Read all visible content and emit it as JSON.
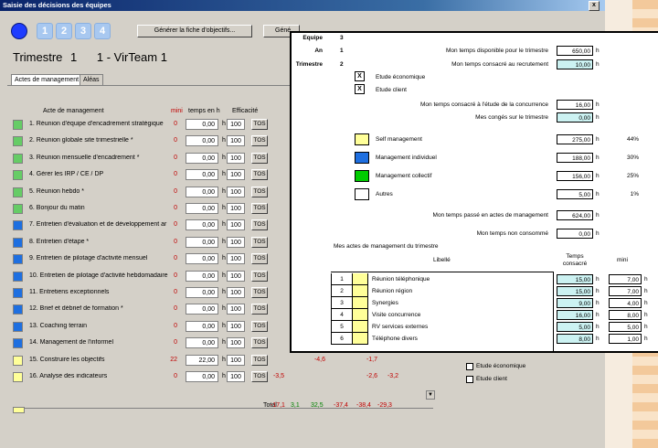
{
  "window": {
    "title": "Saisie des décisions des équipes",
    "close_label": "x"
  },
  "steps": [
    "1",
    "2",
    "3",
    "4"
  ],
  "buttons": {
    "generate_objectives": "Générer la fiche d'objectifs...",
    "generate_partial": "Géné"
  },
  "header": {
    "trimestre_label": "Trimestre",
    "trimestre_value": "1",
    "team": "1 - VirTeam 1"
  },
  "tabs": [
    "Actes de management",
    "Aléas"
  ],
  "columns": {
    "acte": "Acte de management",
    "mini": "mini",
    "temps": "temps en h",
    "efficacite": "Efficacité"
  },
  "hour_unit": "h",
  "tos_label": "TOS",
  "colors": {
    "green": "#66cc66",
    "blue": "#1e6fe0",
    "yellow": "#ffff99",
    "white": "#ffffff",
    "red": "#c00000"
  },
  "rows": [
    {
      "label": "1. Réunion d'équipe d'encadrement stratégique",
      "color": "#66cc66",
      "mini": "0",
      "temps": "0,00",
      "eff": "100",
      "c": []
    },
    {
      "label": "2. Réunion globale site trimestrielle *",
      "color": "#66cc66",
      "mini": "0",
      "temps": "0,00",
      "eff": "100",
      "c": []
    },
    {
      "label": "3. Réunion mensuelle d'encadrement *",
      "color": "#66cc66",
      "mini": "0",
      "temps": "0,00",
      "eff": "100",
      "c": [
        {
          "v": "-3",
          "cls": "red"
        }
      ]
    },
    {
      "label": "4. Gérer les IRP / CE / DP",
      "color": "#66cc66",
      "mini": "0",
      "temps": "0,00",
      "eff": "100",
      "c": []
    },
    {
      "label": "5. Réunion hebdo *",
      "color": "#66cc66",
      "mini": "0",
      "temps": "0,00",
      "eff": "100",
      "c": [
        {
          "v": "-5",
          "cls": "red"
        }
      ]
    },
    {
      "label": "6. Bonjour du matin",
      "color": "#66cc66",
      "mini": "0",
      "temps": "0,00",
      "eff": "100",
      "c": []
    },
    {
      "label": "7. Entretien d'évaluation et de développement ar",
      "color": "#1e6fe0",
      "mini": "0",
      "temps": "0,00",
      "eff": "100",
      "c": [
        {
          "v": "1",
          "cls": "green"
        }
      ]
    },
    {
      "label": "8. Entretien d'étape *",
      "color": "#1e6fe0",
      "mini": "0",
      "temps": "0,00",
      "eff": "100",
      "c": []
    },
    {
      "label": "9. Entretien de pilotage d'activité mensuel",
      "color": "#1e6fe0",
      "mini": "0",
      "temps": "0,00",
      "eff": "100",
      "c": [
        {
          "v": "-5",
          "cls": "red"
        }
      ]
    },
    {
      "label": "10. Entretien de pilotage d'activité hebdomadaire",
      "color": "#1e6fe0",
      "mini": "0",
      "temps": "0,00",
      "eff": "100",
      "c": [
        {
          "v": "-5",
          "cls": "red"
        }
      ]
    },
    {
      "label": "11. Entretiens exceptionnels",
      "color": "#1e6fe0",
      "mini": "0",
      "temps": "0,00",
      "eff": "100",
      "c": []
    },
    {
      "label": "12. Brief et débrief de formation *",
      "color": "#1e6fe0",
      "mini": "0",
      "temps": "0,00",
      "eff": "100",
      "c": []
    },
    {
      "label": "13. Coaching terrain",
      "color": "#1e6fe0",
      "mini": "0",
      "temps": "0,00",
      "eff": "100",
      "c": []
    },
    {
      "label": "14. Management de l'informel",
      "color": "#1e6fe0",
      "mini": "0",
      "temps": "0,00",
      "eff": "100",
      "c": []
    },
    {
      "label": "15. Construire les objectifs",
      "color": "#ffff99",
      "mini": "22",
      "temps": "22,00",
      "eff": "100",
      "c": [
        {
          "v": "-4,6",
          "cls": "red"
        },
        {
          "v": "-1,7",
          "cls": "red"
        }
      ]
    },
    {
      "label": "16. Analyse des indicateurs",
      "color": "#ffff99",
      "mini": "0",
      "temps": "0,00",
      "eff": "100",
      "c": [
        {
          "v": "-3,5",
          "cls": "red"
        },
        {
          "v": "-2,6",
          "cls": "red"
        },
        {
          "v": "-3,2",
          "cls": "red"
        }
      ]
    }
  ],
  "totals": {
    "label": "Total",
    "values": [
      {
        "v": "-17,1",
        "cls": "red"
      },
      {
        "v": "3,1",
        "cls": "green"
      },
      {
        "v": "32,5",
        "cls": "green"
      },
      {
        "v": "-37,4",
        "cls": "red"
      },
      {
        "v": "-38,4",
        "cls": "red"
      },
      {
        "v": "-29,3",
        "cls": "red"
      }
    ]
  },
  "checkboxes": [
    "Etude économique",
    "Etude client"
  ],
  "popup": {
    "equipe_label": "Equipe",
    "equipe_value": "3",
    "an_label": "An",
    "an_value": "1",
    "trimestre_label": "Trimestre",
    "trimestre_value": "2",
    "temps_dispo_label": "Mon temps disponible pour le trimestre",
    "temps_dispo_value": "650,00",
    "temps_recrut_label": "Mon temps consacré au recrutement",
    "temps_recrut_value": "10,00",
    "etude_eco_label": "Etude économique",
    "etude_eco_mark": "X",
    "etude_client_label": "Etude client",
    "etude_client_mark": "X",
    "temps_concurrence_label": "Mon temps consacré à l'étude de la concurrence",
    "temps_concurrence_value": "16,00",
    "conges_label": "Mes congés sur le trimestre",
    "conges_value": "0,00",
    "categories": [
      {
        "label": "Self management",
        "color": "#ffff99",
        "value": "275,00",
        "pct": "44%"
      },
      {
        "label": "Management individuel",
        "color": "#1e6fe0",
        "value": "188,00",
        "pct": "30%"
      },
      {
        "label": "Management collectif",
        "color": "#00cc00",
        "value": "156,00",
        "pct": "25%"
      },
      {
        "label": "Autres",
        "color": "#ffffff",
        "value": "5,00",
        "pct": "1%"
      }
    ],
    "actes_total_label": "Mon temps passé en actes de management",
    "actes_total_value": "624,00",
    "non_consomme_label": "Mon temps non consommé",
    "non_consomme_value": "0,00",
    "actes_list_title": "Mes actes de management du trimestre",
    "table_headers": {
      "libelle": "Libellé",
      "temps": "Temps consacré",
      "mini": "mini"
    },
    "table_rows": [
      {
        "n": "1",
        "label": "Réunion téléphonique",
        "temps": "15,00",
        "mini": "7,00"
      },
      {
        "n": "2",
        "label": "Réunion région",
        "temps": "15,00",
        "mini": "7,00"
      },
      {
        "n": "3",
        "label": "Synergies",
        "temps": "9,00",
        "mini": "4,00"
      },
      {
        "n": "4",
        "label": "Visite concurrence",
        "temps": "16,00",
        "mini": "8,00"
      },
      {
        "n": "5",
        "label": "RV services externes",
        "temps": "5,00",
        "mini": "5,00"
      },
      {
        "n": "6",
        "label": "Téléphone divers",
        "temps": "8,00",
        "mini": "1,00"
      }
    ]
  }
}
